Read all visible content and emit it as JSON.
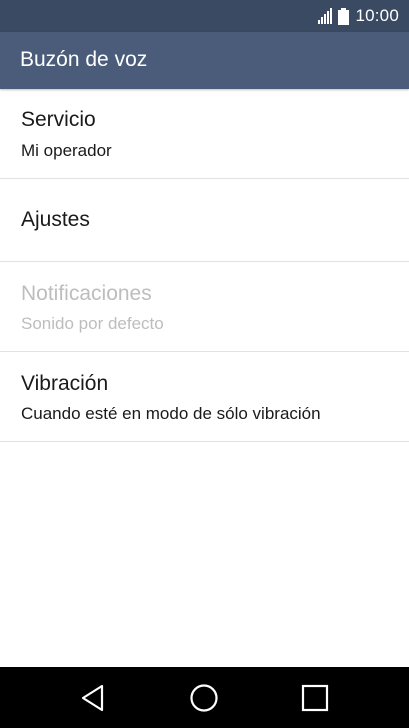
{
  "status_bar": {
    "time": "10:00",
    "icons": [
      "signal-icon",
      "battery-icon"
    ]
  },
  "action_bar": {
    "title": "Buzón de voz"
  },
  "list": {
    "items": [
      {
        "title": "Servicio",
        "subtitle": "Mi operador",
        "enabled": true
      },
      {
        "title": "Ajustes",
        "enabled": true
      },
      {
        "title": "Notificaciones",
        "subtitle": "Sonido por defecto",
        "enabled": false
      },
      {
        "title": "Vibración",
        "subtitle": "Cuando esté en modo de sólo vibración",
        "enabled": true
      }
    ]
  },
  "nav_bar": {
    "icons": [
      "back-icon",
      "home-icon",
      "recents-icon"
    ]
  },
  "colors": {
    "status_bar": "#3a4a62",
    "action_bar": "#4a5c7a",
    "disabled_text": "#bdbdbd",
    "nav_bar": "#000000"
  }
}
